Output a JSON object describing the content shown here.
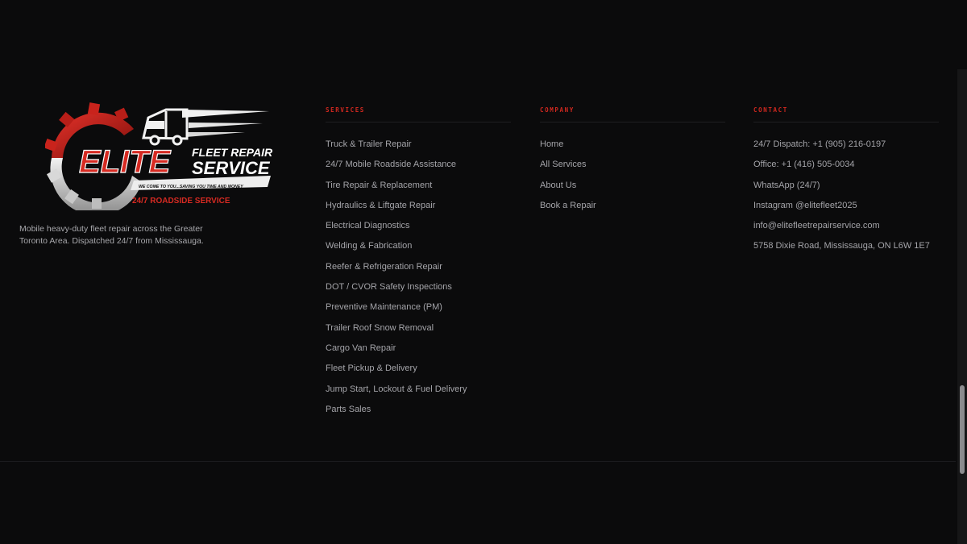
{
  "brand": {
    "logo": {
      "word": "ELITE",
      "line1": "FLEET REPAIR",
      "line2": "SERVICE",
      "slogan": "WE COME TO YOU...SAVING YOU TIME AND MONEY",
      "badge": "24/7 ROADSIDE SERVICE"
    },
    "tagline": "Mobile heavy-duty fleet repair across the Greater Toronto Area. Dispatched 24/7 from Mississauga."
  },
  "services": {
    "heading": "SERVICES",
    "items": [
      "Truck & Trailer Repair",
      "24/7 Mobile Roadside Assistance",
      "Tire Repair & Replacement",
      "Hydraulics & Liftgate Repair",
      "Electrical Diagnostics",
      "Welding & Fabrication",
      "Reefer & Refrigeration Repair",
      "DOT / CVOR Safety Inspections",
      "Preventive Maintenance (PM)",
      "Trailer Roof Snow Removal",
      "Cargo Van Repair",
      "Fleet Pickup & Delivery",
      "Jump Start, Lockout & Fuel Delivery",
      "Parts Sales"
    ]
  },
  "company": {
    "heading": "COMPANY",
    "items": [
      "Home",
      "All Services",
      "About Us",
      "Book a Repair"
    ]
  },
  "contact": {
    "heading": "CONTACT",
    "items": [
      "24/7 Dispatch: +1 (905) 216-0197",
      "Office: +1 (416) 505-0034",
      "WhatsApp (24/7)",
      "Instagram @elitefleet2025",
      "info@elitefleetrepairservice.com",
      "5758 Dixie Road, Mississauga, ON L6W 1E7"
    ]
  },
  "colors": {
    "background": "#0b0b0c",
    "accent": "#d0281f",
    "link": "#a4a4a9"
  }
}
